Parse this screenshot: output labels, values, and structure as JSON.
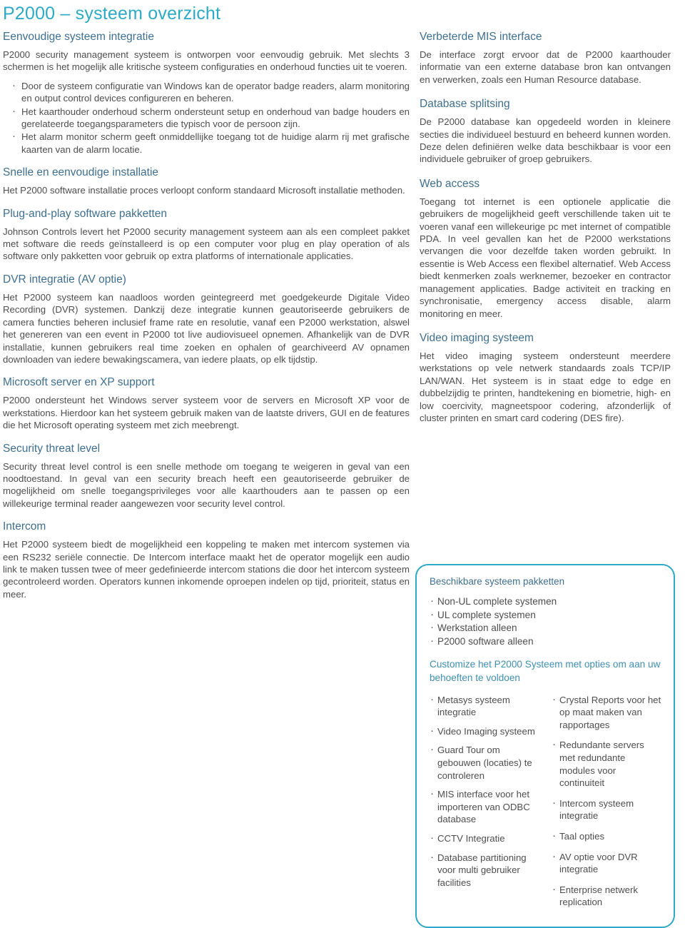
{
  "colors": {
    "title": "#2eaac6",
    "heading": "#3f6f8e",
    "body": "#4e4e4e",
    "box_border": "#2eaac6",
    "cta": "#3f8fb0"
  },
  "title": "P2000 – systeem overzicht",
  "left_column": {
    "sections": [
      {
        "heading": "Eenvoudige systeem integratie",
        "paragraph": "P2000 security management systeem is ontworpen voor eenvoudig gebruik. Met slechts 3 schermen is het mogelijk alle kritische systeem configuraties en onderhoud functies uit te voeren.",
        "bullets": [
          "Door de systeem configuratie van Windows kan de operator badge readers, alarm monitoring en output control devices configureren en beheren.",
          "Het kaarthouder onderhoud scherm ondersteunt setup en onderhoud van badge houders en gerelateerde toegangsparameters die typisch voor de persoon zijn.",
          "Het alarm monitor scherm geeft onmiddellijke toegang tot de huidige alarm rij met grafische kaarten van de alarm locatie."
        ]
      },
      {
        "heading": "Snelle en eenvoudige installatie",
        "paragraph": "Het P2000 software installatie proces verloopt conform standaard Microsoft installatie methoden.",
        "bullets": []
      },
      {
        "heading": "Plug-and-play software pakketten",
        "paragraph": "Johnson Controls levert het P2000 security management systeem aan als een compleet pakket met software die reeds geïnstalleerd is op een computer voor plug en play operation of als software only pakketten voor gebruik op extra platforms of internationale applicaties.",
        "bullets": []
      },
      {
        "heading": "DVR integratie (AV optie)",
        "paragraph": "Het P2000 systeem kan naadloos worden geintegreerd met goedgekeurde Digitale Video Recording (DVR) systemen. Dankzij deze integratie kunnen geautoriseerde gebruikers de camera functies beheren inclusief frame rate en resolutie, vanaf een P2000 werkstation, alswel het genereren van een event in P2000 tot live audiovisueel opnemen. Afhankelijk van de DVR installatie, kunnen gebruikers real time zoeken en ophalen of gearchiveerd AV opnamen downloaden van iedere bewakingscamera, van iedere plaats, op elk tijdstip.",
        "bullets": []
      },
      {
        "heading": "Microsoft server en XP support",
        "paragraph": "P2000 ondersteunt het Windows server systeem voor de servers en Microsoft XP voor de werkstations. Hierdoor kan het systeem gebruik maken van de laatste drivers, GUI en de features die het Microsoft operating systeem met zich meebrengt.",
        "bullets": []
      },
      {
        "heading": "Security threat level",
        "paragraph": "Security threat level control is een snelle methode om toegang te weigeren in geval van een noodtoestand. In geval van een security breach heeft een geautoriseerde gebruiker de mogelijkheid om snelle toegangsprivileges voor alle kaarthouders aan te passen op een willekeurige terminal reader aangewezen voor security level control.",
        "bullets": []
      },
      {
        "heading": "Intercom",
        "paragraph": "Het P2000 systeem biedt de mogelijkheid een koppeling te maken met intercom systemen via een RS232 seriële connectie. De Intercom interface maakt het de operator mogelijk een audio link te maken tussen twee of meer gedefinieerde intercom stations die door het intercom systeem gecontroleerd worden. Operators kunnen inkomende oproepen indelen op tijd, prioriteit, status en meer.",
        "bullets": []
      }
    ]
  },
  "right_column": {
    "sections": [
      {
        "heading": "Verbeterde MIS interface",
        "paragraph": "De interface zorgt ervoor dat de P2000 kaarthouder informatie van een externe database bron kan ontvangen en verwerken, zoals een Human Resource database."
      },
      {
        "heading": "Database splitsing",
        "paragraph": "De P2000 database kan opgedeeld worden in kleinere secties die individueel bestuurd en beheerd kunnen worden. Deze delen definiëren welke data beschikbaar is voor een individuele gebruiker of groep gebruikers."
      },
      {
        "heading": "Web access",
        "paragraph": "Toegang tot internet is een optionele applicatie die gebruikers de mogelijkheid geeft verschillende taken uit te voeren vanaf een willekeurige pc met internet of compatible PDA. In veel gevallen kan het de P2000 werkstations vervangen die voor dezelfde taken worden gebruikt. In essentie is Web Access een flexibel alternatief. Web Access biedt kenmerken zoals werknemer, bezoeker en contractor management applicaties. Badge activiteit en tracking en synchronisatie, emergency access disable, alarm monitoring en meer."
      },
      {
        "heading": "Video imaging systeem",
        "paragraph": "Het video imaging systeem ondersteunt meerdere werkstations op vele netwerk standaards zoals TCP/IP LAN/WAN. Het systeem is in staat edge to edge en dubbelzijdig te printen, handtekening en biometrie, high- en low coercivity, magneetspoor codering, afzonderlijk of cluster printen en smart card codering (DES fire)."
      }
    ],
    "package_box": {
      "title": "Beschikbare systeem pakketten",
      "packages": [
        "Non-UL complete systemen",
        "UL complete systemen",
        "Werkstation alleen",
        "P2000 software alleen"
      ],
      "cta": "Customize het P2000 Systeem met opties om aan uw behoeften te voldoen",
      "options_left": [
        "Metasys systeem integratie",
        "Video Imaging systeem",
        "Guard Tour om gebouwen (locaties) te controleren",
        "MIS interface voor het importeren van ODBC database",
        "CCTV Integratie",
        "Database partitioning voor multi gebruiker facilities"
      ],
      "options_right": [
        "Crystal Reports voor het op maat maken van rapportages",
        "Redundante servers met redundante modules voor continuiteit",
        "Intercom systeem integratie",
        "Taal opties",
        "AV optie voor DVR integratie",
        "Enterprise netwerk replication"
      ]
    }
  }
}
